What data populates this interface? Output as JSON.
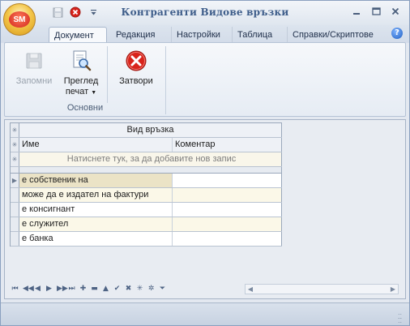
{
  "window": {
    "title": "Контрагенти Видове връзки",
    "app_logo": "SM"
  },
  "ribbon_tabs": [
    {
      "label": "Документ",
      "active": true
    },
    {
      "label": "Редакция"
    },
    {
      "label": "Настройки"
    },
    {
      "label": "Таблица"
    },
    {
      "label": "Справки/Скриптове"
    }
  ],
  "ribbon": {
    "save": {
      "label": "Запомни",
      "icon": "floppy-disk-icon",
      "enabled": false
    },
    "print_preview": {
      "label_line1": "Преглед",
      "label_line2": "печат",
      "icon": "print-preview-icon"
    },
    "close": {
      "label": "Затвори",
      "icon": "close-red-circle-icon"
    },
    "group_label": "Основни"
  },
  "grid": {
    "band_header": "Вид връзка",
    "columns": [
      "Име",
      "Коментар"
    ],
    "new_row_prompt": "Натиснете тук, за да добавите нов запис",
    "rows": [
      {
        "name": "е собственик на",
        "comment": ""
      },
      {
        "name": "може да е издател на фактури",
        "comment": ""
      },
      {
        "name": "е консигнант",
        "comment": ""
      },
      {
        "name": "е служител",
        "comment": ""
      },
      {
        "name": "е банка",
        "comment": ""
      }
    ]
  },
  "colors": {
    "accent": "#3e5d8a",
    "close_red": "#d8231b",
    "row_alt": "#fbf8e8"
  }
}
